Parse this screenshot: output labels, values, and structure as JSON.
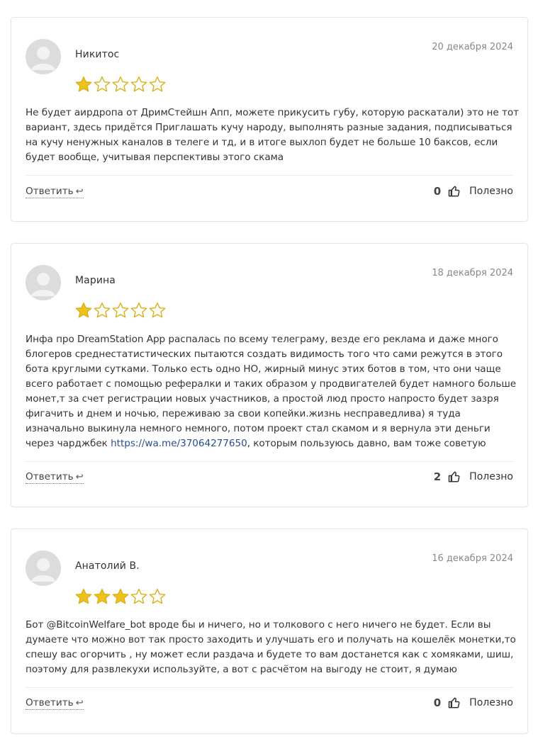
{
  "reviews": [
    {
      "author": "Никитос",
      "date": "20 декабря 2024",
      "rating": 1,
      "text": "Не будет аирдропа от ДримСтейшн Апп, можете прикусить губу, которую раскатали) это не тот вариант, здесь придётся Приглашать кучу народу, выполнять разные задания, подписываться на кучу ненужных каналов в телеге и тд, и в итоге выхлоп будет не больше 10 баксов, если будет вообще, учитывая перспективы этого скама",
      "reply_label": "Ответить",
      "votes": "0",
      "useful_label": "Полезно"
    },
    {
      "author": "Марина",
      "date": "18 декабря 2024",
      "rating": 1,
      "text_before": "Инфа про DreamStation App распалась по всему телеграму, везде его реклама и даже много блогеров среднестатистических пытаются создать видимость того что сами режутся в этого бота круглыми сутками. Только есть одно НО, жирный минус этих ботов в том, что они чаще всего работает с помощью рефералки и таких образом у продвигателей будет намного больше монет,т за счет регистрации новых участников, а простой люд просто напросто будет зазря фигачить и днем и ночью, переживаю за свои копейки.жизнь несправедлива) я туда изначально выкинула немного немного, потом проект стал скамом и я вернула эти деньги через чарджбек ",
      "link": "https://wa.me/37064277650",
      "text_after": ", которым пользуюсь давно, вам тоже советую",
      "reply_label": "Ответить",
      "votes": "2",
      "useful_label": "Полезно"
    },
    {
      "author": "Анатолий В.",
      "date": "16 декабря 2024",
      "rating": 3,
      "text": "Бот @BitcoinWelfare_bot вроде бы и ничего, но и толкового с него ничего не будет. Если вы думаете что можно вот так просто заходить и улучшать его и получать на кошелёк монетки,то спешу вас огорчить , ну может если раздача и будете то вам достанется как с хомяками, шиш, поэтому для развлекухи используйте, а вот с расчётом на выгоду не стоит, я думаю",
      "reply_label": "Ответить",
      "votes": "0",
      "useful_label": "Полезно"
    }
  ],
  "colors": {
    "star_fill": "#ecc21b",
    "star_stroke": "#d9b21a",
    "avatar_bg": "#dcdcdc",
    "link": "#2a4f8a",
    "date": "#888888"
  },
  "icons": {
    "avatar": "user-placeholder-icon",
    "star": "star-icon",
    "reply": "reply-arrow-icon",
    "thumb": "thumbs-up-icon"
  },
  "reply_arrow": "↩"
}
